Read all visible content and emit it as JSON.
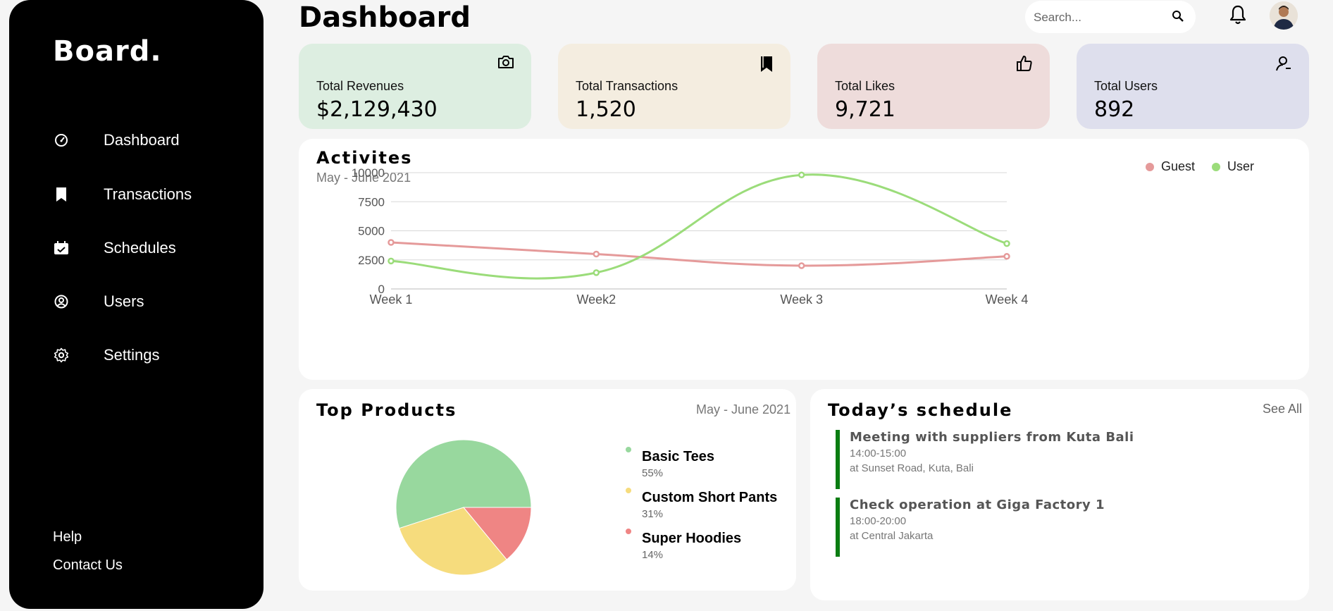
{
  "sidebar": {
    "brand": "Board.",
    "items": [
      {
        "label": "Dashboard",
        "icon": "dashboard-gauge-icon"
      },
      {
        "label": "Transactions",
        "icon": "bookmark-icon"
      },
      {
        "label": "Schedules",
        "icon": "calendar-check-icon"
      },
      {
        "label": "Users",
        "icon": "user-circle-icon"
      },
      {
        "label": "Settings",
        "icon": "gear-icon"
      }
    ],
    "help": "Help",
    "contact": "Contact Us"
  },
  "header": {
    "title": "Dashboard",
    "search_placeholder": "Search..."
  },
  "cards": [
    {
      "label": "Total Revenues",
      "value": "$2,129,430",
      "icon": "camera-icon",
      "bg": "#ddeee1"
    },
    {
      "label": "Total Transactions",
      "value": "1,520",
      "icon": "bookmark-icon",
      "bg": "#f4ede0"
    },
    {
      "label": "Total Likes",
      "value": "9,721",
      "icon": "thumbs-up-icon",
      "bg": "#eedcdb"
    },
    {
      "label": "Total Users",
      "value": "892",
      "icon": "users-icon",
      "bg": "#dedfed"
    }
  ],
  "activities": {
    "title": "Activites",
    "subtitle": "May - June 2021"
  },
  "chart_data": [
    {
      "type": "line",
      "title": "Activites",
      "subtitle": "May - June 2021",
      "categories": [
        "Week 1",
        "Week2",
        "Week 3",
        "Week 4"
      ],
      "yticks": [
        "0",
        "2500",
        "5000",
        "7500",
        "10000"
      ],
      "ylim": [
        0,
        10000
      ],
      "grid": true,
      "legend_position": "top-right",
      "series": [
        {
          "name": "Guest",
          "color": "#e59a9a",
          "values": [
            4000,
            3000,
            2000,
            2800
          ]
        },
        {
          "name": "User",
          "color": "#9bdc7a",
          "values": [
            2400,
            1400,
            9800,
            3900
          ]
        }
      ]
    },
    {
      "type": "pie",
      "title": "Top Products",
      "subtitle": "May - June 2021",
      "series": [
        {
          "name": "Basic Tees",
          "value": 55,
          "label": "55%",
          "color": "#98d89e"
        },
        {
          "name": "Custom Short Pants",
          "value": 31,
          "label": "31%",
          "color": "#f6dc7d"
        },
        {
          "name": "Super Hoodies",
          "value": 14,
          "label": "14%",
          "color": "#ef8584"
        }
      ]
    }
  ],
  "products": {
    "title": "Top Products",
    "subtitle": "May - June 2021"
  },
  "schedule": {
    "title": "Today’s schedule",
    "see_all": "See All",
    "items": [
      {
        "title": "Meeting with suppliers from Kuta Bali",
        "time": "14:00-15:00",
        "location": "at Sunset Road, Kuta, Bali"
      },
      {
        "title": "Check operation at Giga Factory 1",
        "time": "18:00-20:00",
        "location": "at Central Jakarta"
      }
    ]
  }
}
